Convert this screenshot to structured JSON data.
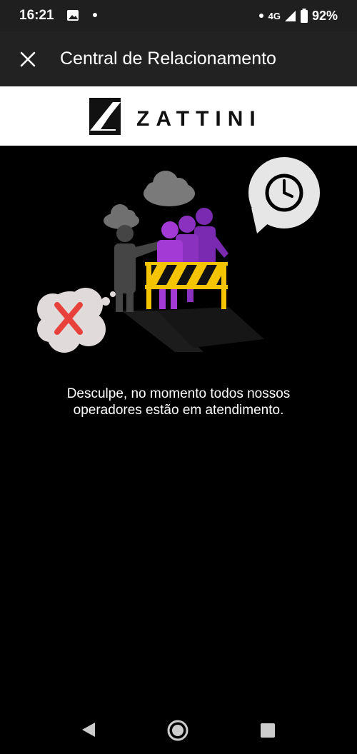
{
  "status_bar": {
    "time": "16:21",
    "network": "4G",
    "battery": "92%",
    "icons": [
      "image-notification-icon",
      "dot-icon",
      "signal-icon",
      "battery-icon"
    ]
  },
  "app_bar": {
    "title": "Central de Relacionamento",
    "close_icon": "close-icon"
  },
  "brand": {
    "name": "ZATTINI"
  },
  "message": {
    "line1": "Desculpe, no momento todos nossos",
    "line2": "operadores estão em atendimento."
  },
  "nav_bar": {
    "icons": [
      "back-icon",
      "home-icon",
      "recents-icon"
    ]
  },
  "colors": {
    "background": "#000000",
    "app_bar": "#222222",
    "status_bar": "#1f1f1f",
    "brand_bar": "#ffffff",
    "purple": "#9b30c9",
    "barrier_yellow": "#f5c400",
    "error_red": "#e8403a"
  }
}
